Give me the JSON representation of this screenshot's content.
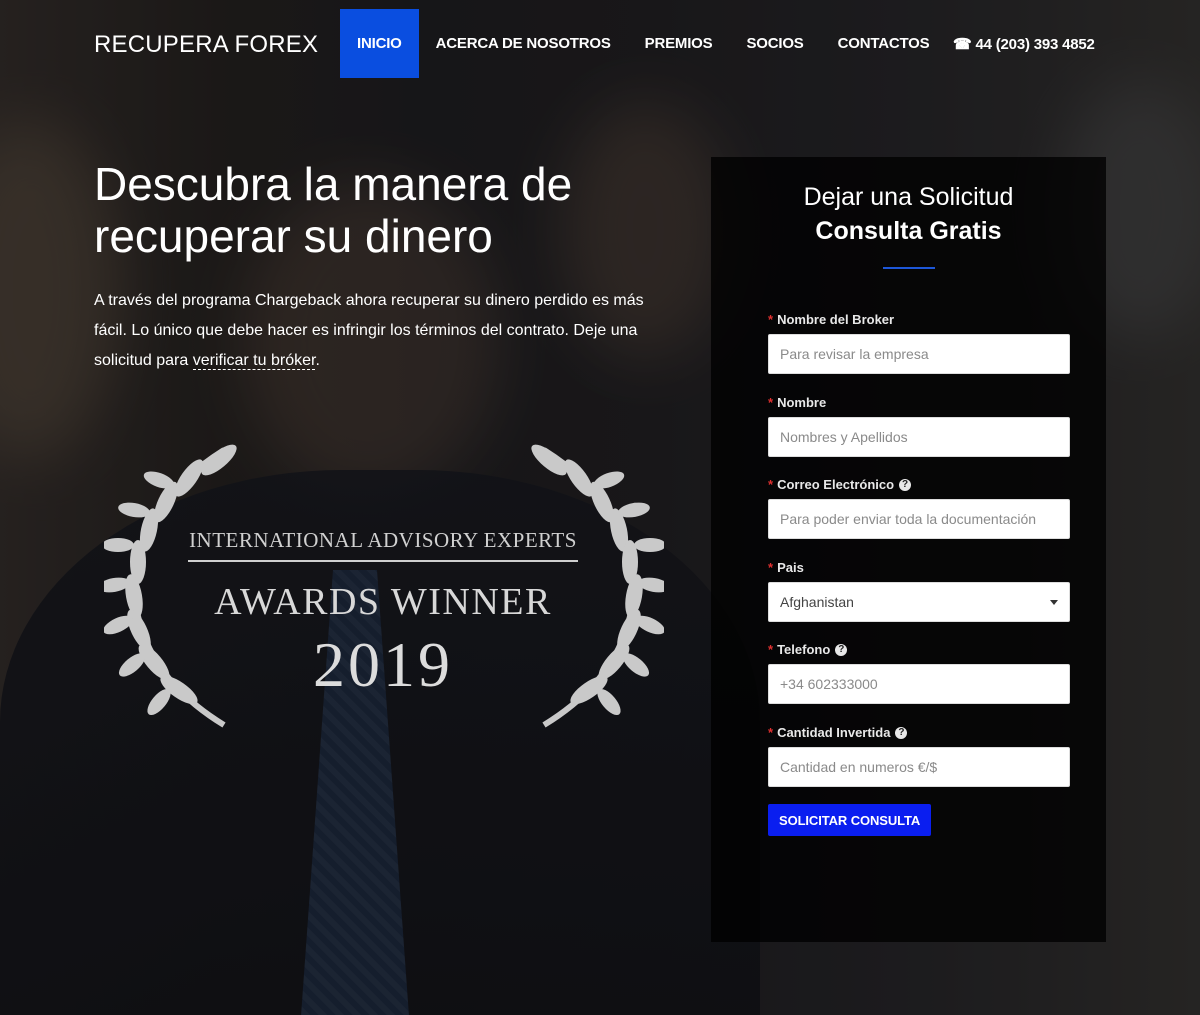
{
  "brand": "RECUPERA FOREX",
  "nav": {
    "items": [
      {
        "label": "INICIO",
        "active": true
      },
      {
        "label": "ACERCA DE NOSOTROS",
        "active": false
      },
      {
        "label": "PREMIOS",
        "active": false
      },
      {
        "label": "SOCIOS",
        "active": false
      },
      {
        "label": "CONTACTOS",
        "active": false
      }
    ],
    "phone_icon": "phone-icon",
    "phone": "44 (203) 393 4852"
  },
  "hero": {
    "title": "Descubra la manera de recuperar su dinero",
    "text": "A través del programa Chargeback ahora recuperar su dinero perdido es más fácil. Lo único que debe hacer es infringir los términos del contrato. Deje una solicitud para ",
    "link": "verificar tu bróker",
    "text_end": "."
  },
  "award": {
    "line1": "INTERNATIONAL ADVISORY EXPERTS",
    "line2": "AWARDS WINNER",
    "year": "2019"
  },
  "form": {
    "title": "Dejar una Solicitud",
    "subtitle": "Consulta Gratis",
    "fields": {
      "broker": {
        "label": "Nombre del Broker",
        "placeholder": "Para revisar la empresa"
      },
      "name": {
        "label": "Nombre",
        "placeholder": "Nombres y Apellidos"
      },
      "email": {
        "label": "Correo Electrónico",
        "placeholder": "Para poder enviar toda la documentación"
      },
      "country": {
        "label": "Pais",
        "value": "Afghanistan"
      },
      "phone": {
        "label": "Telefono",
        "placeholder": "+34 602333000"
      },
      "amount": {
        "label": "Cantidad Invertida",
        "placeholder": "Cantidad en numeros €/$"
      }
    },
    "submit": "SOLICITAR CONSULTA"
  },
  "colors": {
    "accent": "#0a4ee0",
    "submit": "#0a1ef0",
    "required": "#e03030"
  }
}
